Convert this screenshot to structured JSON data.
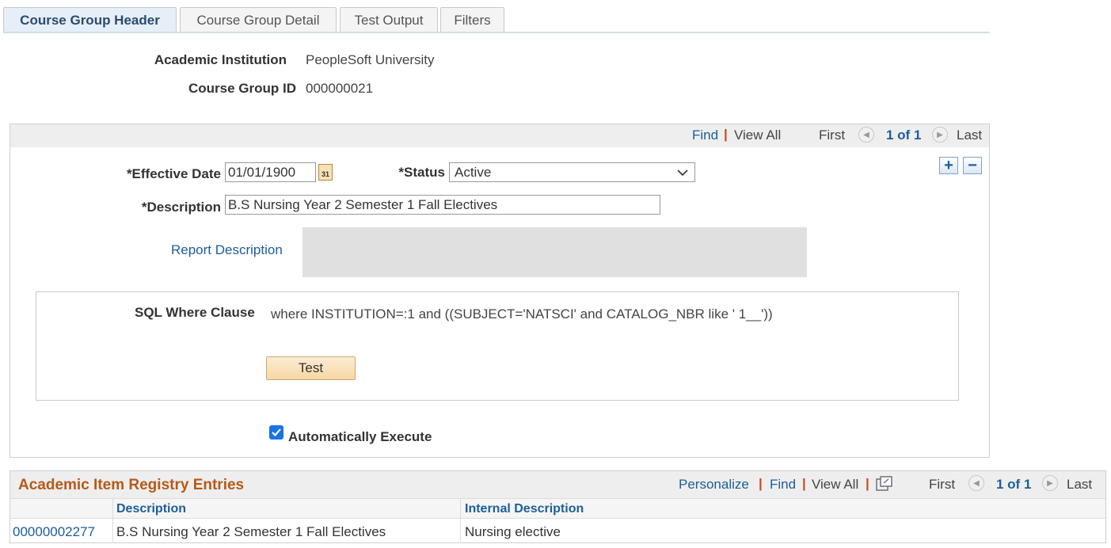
{
  "tabs": [
    {
      "label": "Course Group Header",
      "active": true
    },
    {
      "label": "Course Group Detail",
      "active": false
    },
    {
      "label": "Test Output",
      "active": false
    },
    {
      "label": "Filters",
      "active": false
    }
  ],
  "header": {
    "institution_label": "Academic Institution",
    "institution_value": "PeopleSoft University",
    "group_id_label": "Course Group ID",
    "group_id_value": "000000021"
  },
  "effdt_nav": {
    "find": "Find",
    "view_all": "View All",
    "first": "First",
    "counter": "1 of 1",
    "last": "Last"
  },
  "form": {
    "effective_date_label": "*Effective Date",
    "effective_date_value": "01/01/1900",
    "calendar_icon_text": "31",
    "status_label": "*Status",
    "status_value": "Active",
    "description_label": "*Description",
    "description_value": "B.S Nursing Year 2 Semester 1 Fall Electives",
    "report_description_link": "Report Description",
    "report_description_value": "",
    "sql_label": "SQL Where Clause",
    "sql_value": "where INSTITUTION=:1 and ((SUBJECT='NATSCI' and CATALOG_NBR like ' 1__'))",
    "test_button": "Test",
    "auto_execute_label": "Automatically Execute",
    "auto_execute_checked": true
  },
  "registry": {
    "title": "Academic Item Registry Entries",
    "personalize": "Personalize",
    "find": "Find",
    "view_all": "View All",
    "first": "First",
    "counter": "1 of 1",
    "last": "Last",
    "columns": [
      "",
      "Description",
      "Internal Description"
    ],
    "rows": [
      {
        "id": "00000002277",
        "description": "B.S Nursing Year 2 Semester 1 Fall Electives",
        "internal": "Nursing elective"
      }
    ]
  },
  "colors": {
    "link": "#1d5e9a",
    "grid_title": "#b65a17",
    "separator": "#c74a1d"
  }
}
